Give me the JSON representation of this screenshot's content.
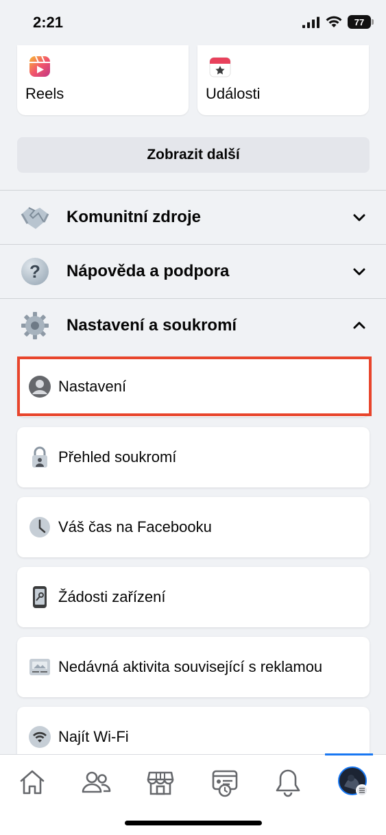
{
  "status_bar": {
    "time": "2:21",
    "battery": "77"
  },
  "shortcuts": [
    {
      "label": "Reels",
      "icon": "reels-icon"
    },
    {
      "label": "Události",
      "icon": "events-calendar-icon"
    }
  ],
  "show_more_label": "Zobrazit další",
  "sections": [
    {
      "label": "Komunitní zdroje",
      "icon": "handshake-icon",
      "expanded": false
    },
    {
      "label": "Nápověda a podpora",
      "icon": "question-mark-icon",
      "expanded": false
    },
    {
      "label": "Nastavení a soukromí",
      "icon": "gear-icon",
      "expanded": true
    }
  ],
  "settings_items": [
    {
      "label": "Nastavení",
      "icon": "profile-icon",
      "highlighted": true
    },
    {
      "label": "Přehled soukromí",
      "icon": "lock-icon"
    },
    {
      "label": "Váš čas na Facebooku",
      "icon": "clock-icon"
    },
    {
      "label": "Žádosti zařízení",
      "icon": "phone-key-icon"
    },
    {
      "label": "Nedávná aktivita související s reklamou",
      "icon": "ad-activity-icon"
    },
    {
      "label": "Najít Wi-Fi",
      "icon": "wifi-icon"
    }
  ],
  "tab_bar": {
    "tabs": [
      "home-icon",
      "friends-icon",
      "marketplace-icon",
      "memories-icon",
      "notifications-icon",
      "menu-avatar-icon"
    ],
    "active": "menu-avatar-icon"
  },
  "colors": {
    "accent": "#1877f2",
    "highlight": "#e8452c",
    "background": "#f0f2f5"
  }
}
